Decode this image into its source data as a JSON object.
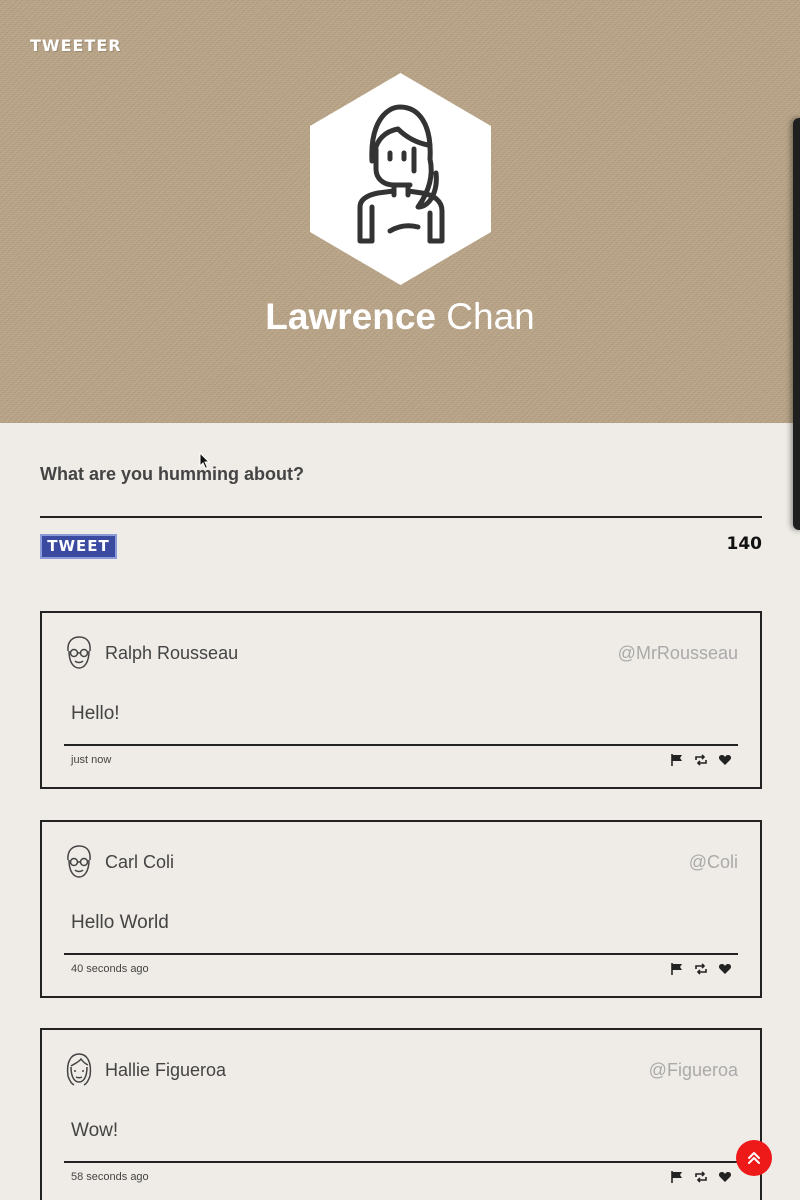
{
  "header": {
    "brand": "TWEETER",
    "first_name": "Lawrence",
    "last_name": "Chan"
  },
  "compose": {
    "label": "What are you humming about?",
    "placeholder": "",
    "button_label": "TWEET",
    "counter": "140"
  },
  "tweets": [
    {
      "name": "Ralph Rousseau",
      "handle": "@MrRousseau",
      "body": "Hello!",
      "time": "just now",
      "avatar": "man-glasses-icon"
    },
    {
      "name": "Carl Coli",
      "handle": "@Coli",
      "body": "Hello World",
      "time": "40 seconds ago",
      "avatar": "man-glasses-icon"
    },
    {
      "name": "Hallie Figueroa",
      "handle": "@Figueroa",
      "body": "Wow!",
      "time": "58 seconds ago",
      "avatar": "woman-icon"
    }
  ],
  "colors": {
    "hero_bg": "#bba689",
    "page_bg": "#efece7",
    "tweet_button_bg": "#3a4aa0",
    "scroll_top_bg": "#ee1a1a"
  }
}
